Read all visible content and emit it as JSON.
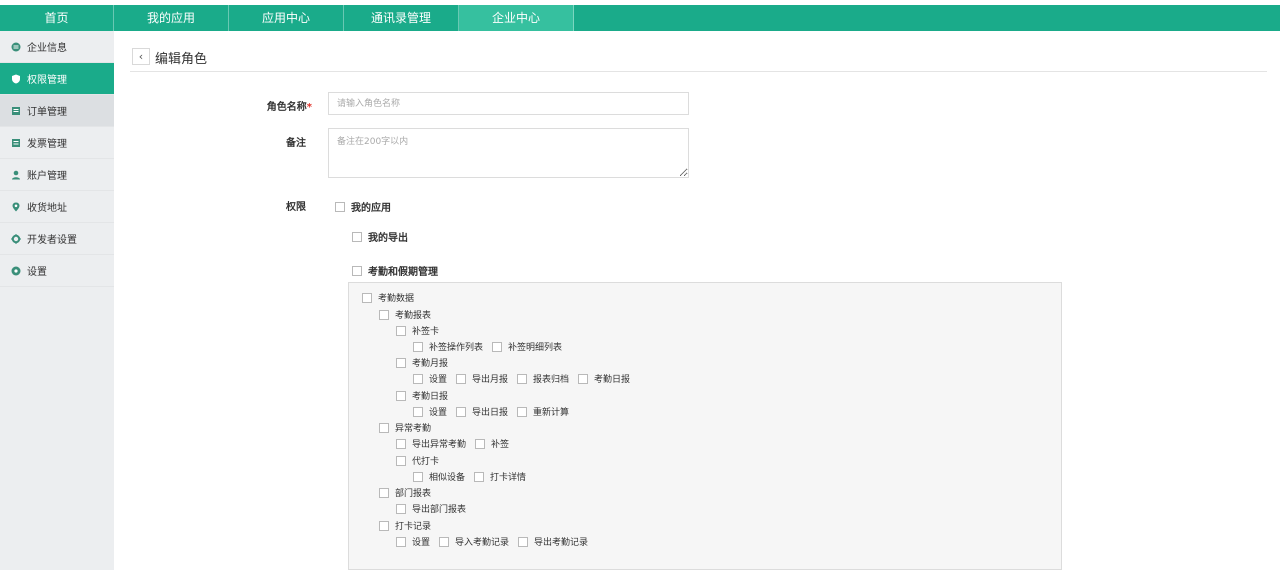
{
  "nav": {
    "items": [
      "首页",
      "我的应用",
      "应用中心",
      "通讯录管理",
      "企业中心"
    ],
    "active_index": 4
  },
  "sidebar": {
    "items": [
      {
        "label": "企业信息",
        "icon": "company-icon"
      },
      {
        "label": "权限管理",
        "icon": "shield-icon"
      },
      {
        "label": "订单管理",
        "icon": "order-icon"
      },
      {
        "label": "发票管理",
        "icon": "invoice-icon"
      },
      {
        "label": "账户管理",
        "icon": "user-icon"
      },
      {
        "label": "收货地址",
        "icon": "location-icon"
      },
      {
        "label": "开发者设置",
        "icon": "gear-icon"
      },
      {
        "label": "设置",
        "icon": "settings-icon"
      }
    ],
    "active_index": 1
  },
  "page": {
    "back_label": "‹",
    "title": "编辑角色"
  },
  "form": {
    "role_name_label": "角色名称",
    "role_name_required": "*",
    "role_name_placeholder": "请输入角色名称",
    "remark_label": "备注",
    "remark_placeholder": "备注在200字以内",
    "permission_label": "权限"
  },
  "permissions": {
    "my_apps": "我的应用",
    "my_export": "我的导出",
    "attendance_mgmt": "考勤和假期管理",
    "attendance_data": "考勤数据",
    "attendance_report": "考勤报表",
    "supplement_card": "补签卡",
    "supplement_op_list": "补签操作列表",
    "supplement_detail_list": "补签明细列表",
    "monthly_report": "考勤月报",
    "monthly_settings": "设置",
    "export_monthly": "导出月报",
    "report_archive": "报表归档",
    "daily_report_link": "考勤日报",
    "daily_report": "考勤日报",
    "daily_settings": "设置",
    "export_daily": "导出日报",
    "recalculate": "重新计算",
    "abnormal": "异常考勤",
    "export_abnormal": "导出异常考勤",
    "supplement": "补签",
    "proxy_card": "代打卡",
    "similar_device": "相似设备",
    "punch_detail": "打卡详情",
    "dept_report": "部门报表",
    "export_dept_report": "导出部门报表",
    "punch_record": "打卡记录",
    "punch_settings": "设置",
    "import_records": "导入考勤记录",
    "export_records": "导出考勤记录"
  },
  "colors": {
    "brand": "#1aab8a",
    "brand_active": "#36c09f",
    "required": "#e0322a"
  }
}
